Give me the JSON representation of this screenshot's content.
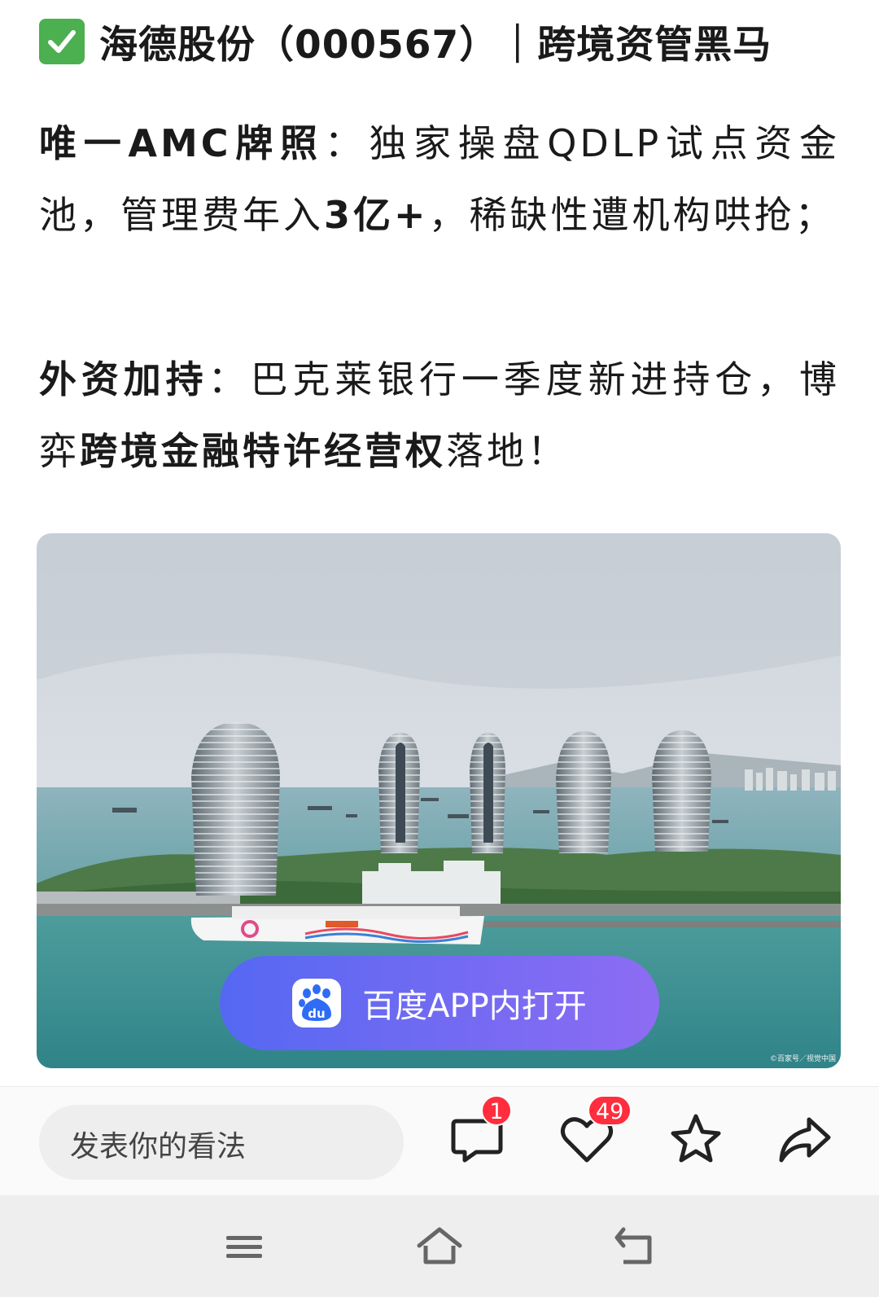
{
  "article": {
    "title": "海德股份（000567）｜跨境资管黑马",
    "p1": {
      "label": "唯一AMC牌照",
      "sep": "：",
      "text1": "独家操盘QDLP试点资金池，管理费年入",
      "highlight": "3亿+",
      "text2": "，稀缺性遭机构哄抢；"
    },
    "p2": {
      "label": "外资加持",
      "sep": "：",
      "text1": "巴克莱银行一季度新进持仓，博弈",
      "highlight": "跨境金融特许经营权",
      "text2": "落地！"
    }
  },
  "image": {
    "credit": "©百家号／视觉中国",
    "open_app_label": "百度APP内打开"
  },
  "action_bar": {
    "comment_placeholder": "发表你的看法",
    "comment_count": "1",
    "like_count": "49"
  },
  "icons": [
    "check-mark-icon",
    "baidu-paw-icon",
    "comment-icon",
    "heart-icon",
    "star-icon",
    "share-icon",
    "menu-icon",
    "home-icon",
    "back-icon"
  ],
  "colors": {
    "accent": "#6a6cf3",
    "badge": "#ff2d3d",
    "check": "#4caf50"
  }
}
